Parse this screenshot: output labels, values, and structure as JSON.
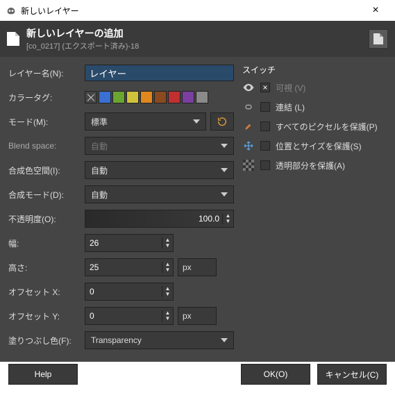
{
  "window": {
    "title": "新しいレイヤー"
  },
  "header": {
    "title": "新しいレイヤーの追加",
    "subtitle": "[co_0217] (エクスポート済み)-18"
  },
  "fields": {
    "layer_name_label": "レイヤー名(N):",
    "layer_name_value": "レイヤー",
    "color_tag_label": "カラータグ:",
    "mode_label": "モード(M):",
    "mode_value": "標準",
    "blend_space_label": "Blend space:",
    "blend_space_value": "自動",
    "composite_space_label": "合成色空間(I):",
    "composite_space_value": "自動",
    "composite_mode_label": "合成モード(D):",
    "composite_mode_value": "自動",
    "opacity_label": "不透明度(O):",
    "opacity_value": "100.0",
    "width_label": "幅:",
    "width_value": "26",
    "height_label": "高さ:",
    "height_value": "25",
    "height_unit": "px",
    "offset_x_label": "オフセット X:",
    "offset_x_value": "0",
    "offset_y_label": "オフセット Y:",
    "offset_y_value": "0",
    "offset_unit": "px",
    "fill_label": "塗りつぶし色(F):",
    "fill_value": "Transparency"
  },
  "switches": {
    "title": "スイッチ",
    "visible": "可視 (V)",
    "linked": "連結 (L)",
    "lock_pixels": "すべてのピクセルを保護(P)",
    "lock_position": "位置とサイズを保護(S)",
    "lock_alpha": "透明部分を保護(A)"
  },
  "buttons": {
    "help": "Help",
    "ok": "OK(O)",
    "cancel": "キャンセル(C)"
  },
  "colors": {
    "tags": [
      "#3a3a3a",
      "#3b6fd1",
      "#6aa530",
      "#d1c23b",
      "#e0871e",
      "#8a4a1e",
      "#c03030",
      "#7a3fa0",
      "#8a8a8a"
    ]
  }
}
